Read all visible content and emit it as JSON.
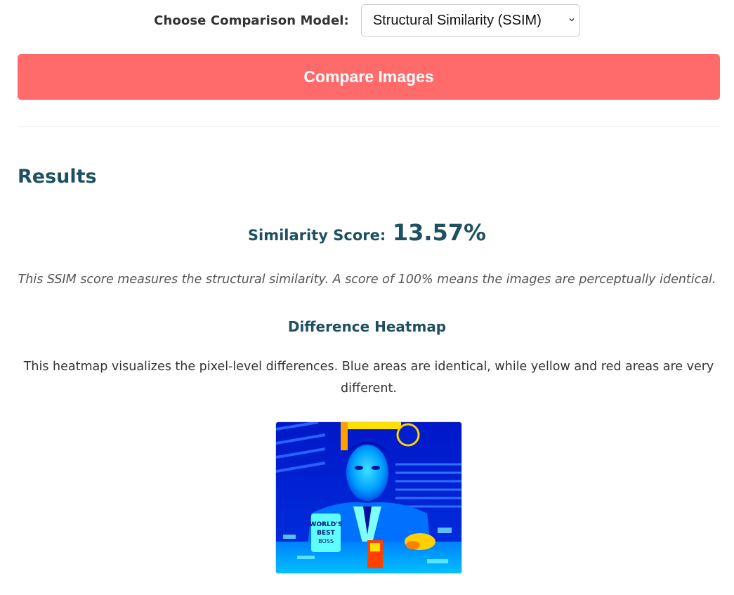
{
  "controls": {
    "model_label": "Choose Comparison Model:",
    "model_selected": "Structural Similarity (SSIM)",
    "compare_button": "Compare Images"
  },
  "results": {
    "title": "Results",
    "score_label": "Similarity Score:",
    "score_value": "13.57%",
    "score_note": "This SSIM score measures the structural similarity. A score of 100% means the images are perceptually identical.",
    "heatmap_title": "Difference Heatmap",
    "heatmap_description": "This heatmap visualizes the pixel-level differences. Blue areas are identical, while yellow and red areas are very different.",
    "heatmap_mug_text": [
      "WORLD'S",
      "BEST",
      "BOSS"
    ]
  },
  "colors": {
    "accent_button": "#ff6b6b",
    "heading": "#1e5062",
    "heatmap_low": "#0000cc",
    "heatmap_mid": "#00c8ff",
    "heatmap_high_yellow": "#ffff00",
    "heatmap_high_red": "#ff2000"
  }
}
